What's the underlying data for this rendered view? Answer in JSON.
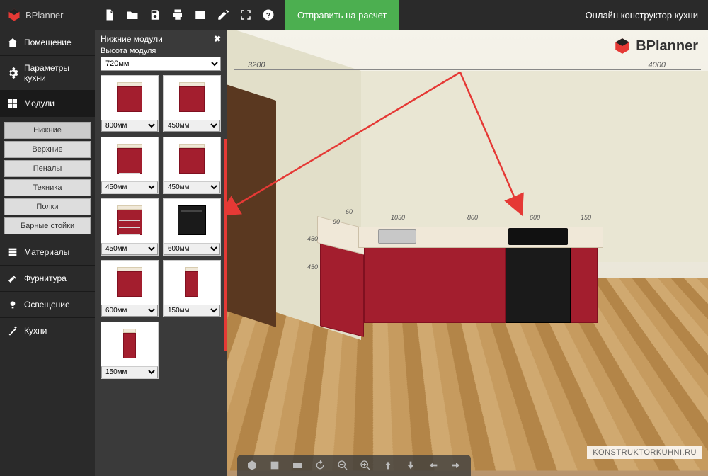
{
  "app": {
    "name": "BPlanner",
    "title": "Онлайн конструктор кухни"
  },
  "topbar": {
    "send": "Отправить на расчет"
  },
  "sidebar": {
    "items": [
      {
        "label": "Помещение",
        "icon": "home"
      },
      {
        "label": "Параметры кухни",
        "icon": "gear"
      },
      {
        "label": "Модули",
        "icon": "modules",
        "active": true
      },
      {
        "label": "Материалы",
        "icon": "materials"
      },
      {
        "label": "Фурнитура",
        "icon": "hammer"
      },
      {
        "label": "Освещение",
        "icon": "light"
      },
      {
        "label": "Кухни",
        "icon": "wand"
      }
    ],
    "subItems": [
      "Нижние",
      "Верхние",
      "Пеналы",
      "Техника",
      "Полки",
      "Барные стойки"
    ]
  },
  "panel": {
    "title": "Нижние модули",
    "heightLabel": "Высота модуля",
    "heightValue": "720мм",
    "modules": [
      {
        "w": "800мм",
        "type": "cab"
      },
      {
        "w": "450мм",
        "type": "cab"
      },
      {
        "w": "450мм",
        "type": "drawers"
      },
      {
        "w": "450мм",
        "type": "cab"
      },
      {
        "w": "450мм",
        "type": "drawers"
      },
      {
        "w": "600мм",
        "type": "oven"
      },
      {
        "w": "600мм",
        "type": "cab"
      },
      {
        "w": "150мм",
        "type": "narrow"
      },
      {
        "w": "150мм",
        "type": "narrow"
      }
    ]
  },
  "scene": {
    "roomDims": {
      "left": "3200",
      "right": "4000"
    },
    "kitchenDims": [
      "60",
      "1050",
      "800",
      "600",
      "150",
      "450",
      "90",
      "450"
    ],
    "watermark": "KONSTRUKTORKUHNI.RU"
  }
}
